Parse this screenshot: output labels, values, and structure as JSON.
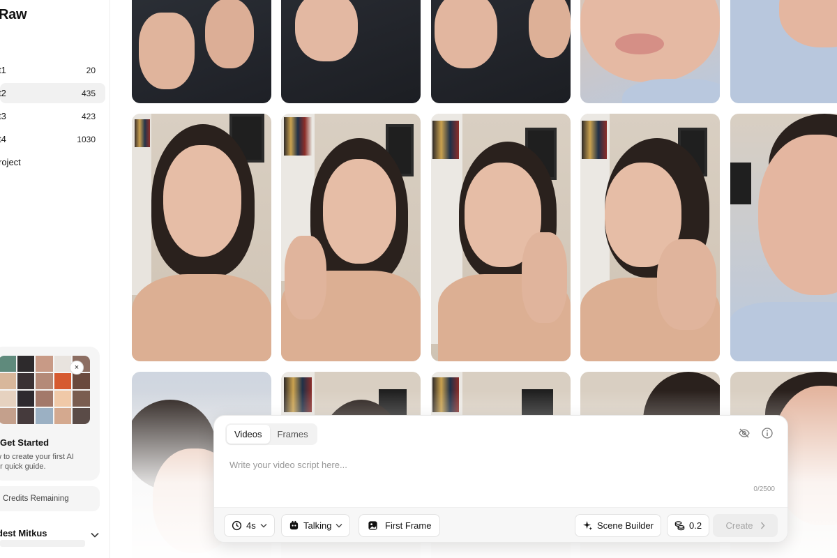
{
  "sidebar": {
    "title": "Raw",
    "items": [
      {
        "label": "t1",
        "count": "20"
      },
      {
        "label": "t2",
        "count": "435"
      },
      {
        "label": "t3",
        "count": "423"
      },
      {
        "label": "t4",
        "count": "1030"
      },
      {
        "label": "roject",
        "count": ""
      }
    ],
    "active_index": 1,
    "get_started": {
      "title": "Get Started",
      "text": "w to create your first AI\nur quick guide.",
      "close_label": "×"
    },
    "credits_label": "Credits Remaining",
    "user_name": "dest Mitkus"
  },
  "composer": {
    "tabs": [
      {
        "label": "Videos",
        "active": true
      },
      {
        "label": "Frames",
        "active": false
      }
    ],
    "placeholder": "Write your video script here...",
    "char_counter": "0/2500",
    "duration": "4s",
    "mode": "Talking",
    "first_frame_label": "First Frame",
    "scene_builder_label": "Scene Builder",
    "cost": "0.2",
    "create_label": "Create",
    "icons": [
      "eye-off-icon",
      "info-icon"
    ]
  },
  "colors": {
    "skin": "#e3b8a2",
    "hair": "#2a211d",
    "wall": "#d9cfc2",
    "sweater": "#26292f",
    "pillow": "#b9c8de"
  }
}
